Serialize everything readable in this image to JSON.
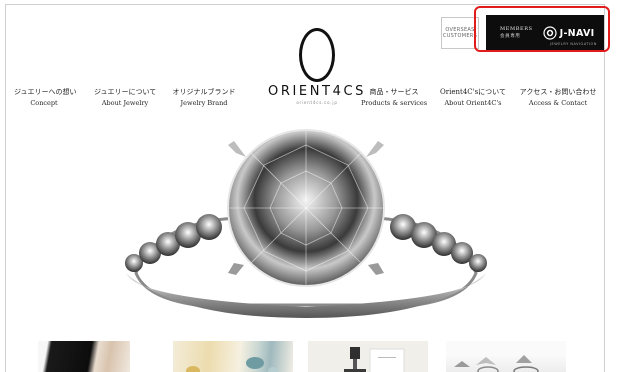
{
  "header": {
    "overseas_button": {
      "line1": "OVERSEAS",
      "line2": "CUSTOMERS"
    },
    "members_button": {
      "label": "MEMBERS",
      "sub_label": "会員専用",
      "jnavi_label": "J-NAVI",
      "jnavi_sub": "JEWELRY NAVIGATION"
    },
    "highlight_color": "#e21c1c"
  },
  "brand": {
    "name": "ORIENT4CS",
    "tagline": "orient4cs.co.jp"
  },
  "nav": {
    "items": [
      {
        "jp": "ジュエリーへの想い",
        "en": "Concept"
      },
      {
        "jp": "ジュエリーについて",
        "en": "About Jewelry"
      },
      {
        "jp": "オリジナルブランド",
        "en": "Jewelry Brand"
      },
      {
        "jp": "商品・サービス",
        "en": "Products & services"
      },
      {
        "jp": "Orient4C'sについて",
        "en": "About Orient4C's"
      },
      {
        "jp": "アクセス・お問い合わせ",
        "en": "Access & Contact"
      }
    ]
  },
  "hero": {
    "image": "diamond-solitaire-ring-with-pave-band"
  },
  "thumbnails": [
    {
      "image": "black-jewelry-box-photo"
    },
    {
      "image": "gemstones-on-paper-photo"
    },
    {
      "image": "ring-on-stand-with-card-photo"
    },
    {
      "image": "silver-rings-photo"
    }
  ]
}
